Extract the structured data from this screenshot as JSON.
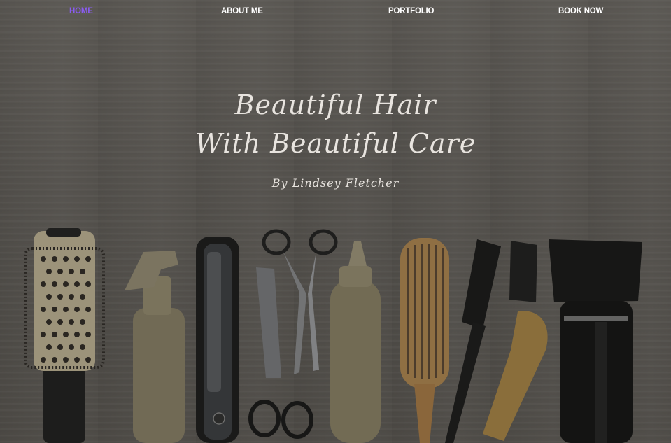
{
  "nav": {
    "items": [
      {
        "label": "HOME",
        "active": true
      },
      {
        "label": "ABOUT ME",
        "active": false
      },
      {
        "label": "PORTFOLIO",
        "active": false
      },
      {
        "label": "BOOK NOW",
        "active": false
      }
    ]
  },
  "hero": {
    "title_line1": "Beautiful Hair",
    "title_line2": "With Beautiful Care",
    "byline": "By Lindsey Fletcher"
  },
  "colors": {
    "nav_text": "#ffffff",
    "nav_active": "#8a5cf0",
    "hero_text": "#e8e4df"
  }
}
